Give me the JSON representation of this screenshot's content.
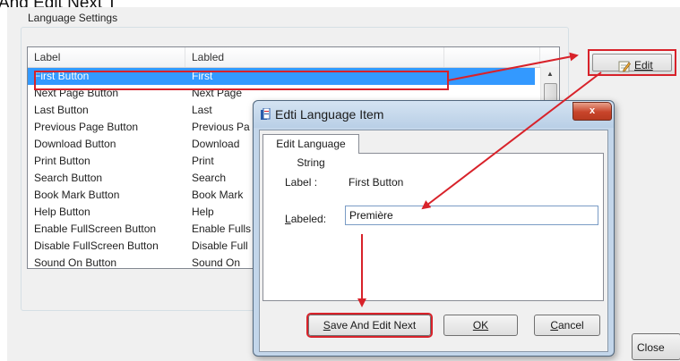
{
  "heading": {
    "text": "And Edit Next T"
  },
  "settings": {
    "group_title": "Language Settings",
    "columns": [
      "Label",
      "Labled"
    ],
    "rows": [
      {
        "label": "First Button",
        "labled": "First",
        "selected": true
      },
      {
        "label": "Next Page Button",
        "labled": "Next Page",
        "selected": false
      },
      {
        "label": "Last Button",
        "labled": "Last",
        "selected": false
      },
      {
        "label": "Previous Page Button",
        "labled": "Previous Pa",
        "selected": false
      },
      {
        "label": "Download Button",
        "labled": "Download",
        "selected": false
      },
      {
        "label": "Print Button",
        "labled": "Print",
        "selected": false
      },
      {
        "label": "Search Button",
        "labled": "Search",
        "selected": false
      },
      {
        "label": "Book Mark Button",
        "labled": "Book Mark",
        "selected": false
      },
      {
        "label": "Help Button",
        "labled": "Help",
        "selected": false
      },
      {
        "label": "Enable FullScreen Button",
        "labled": "Enable Fulls",
        "selected": false
      },
      {
        "label": "Disable FullScreen Button",
        "labled": "Disable Full",
        "selected": false
      },
      {
        "label": "Sound On Button",
        "labled": "Sound On",
        "selected": false
      }
    ],
    "edit_button": {
      "label": "Edit",
      "icon": "edit-pencil-icon"
    },
    "close_button": {
      "label": "Close"
    }
  },
  "dialog": {
    "title": "Edti Language Item",
    "close_glyph": "x",
    "tab": "Edit Language String",
    "label_key": "Label :",
    "label_value": "First Button",
    "labeled_key": "Labeled:",
    "labeled_value": "Première",
    "buttons": {
      "save_next": "Save And Edit Next",
      "ok": "OK",
      "cancel": "Cancel"
    }
  },
  "colors": {
    "selection": "#3399ff",
    "annotation_red": "#d8222a",
    "dialog_frame": "#c3d6ea"
  }
}
